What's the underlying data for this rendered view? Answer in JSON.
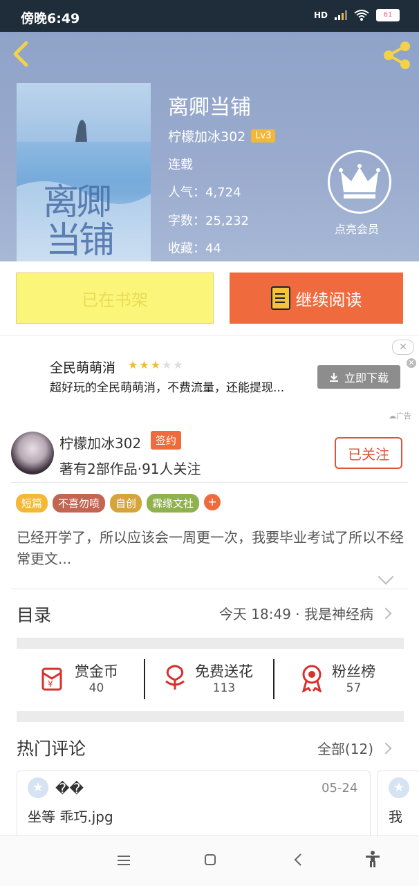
{
  "status": {
    "time": "傍晚6:49",
    "network": "HD",
    "battery": "61"
  },
  "book": {
    "title": "离卿当铺",
    "cover_text_1": "离卿",
    "cover_text_2": "当铺",
    "author": "柠檬加冰302",
    "level": "Lv3",
    "status": "连载",
    "popularity": "人气：4,724",
    "words": "字数：25,232",
    "favorites": "收藏：44",
    "member_label": "点亮会员"
  },
  "actions": {
    "shelf_label": "已在书架",
    "read_label": "继续阅读"
  },
  "ad": {
    "title": "全民萌萌消",
    "rating": 3,
    "desc": "超好玩的全民萌萌消，不费流量，还能提现...",
    "download_label": "立即下载",
    "close": "✕",
    "tag": "广告"
  },
  "author": {
    "name": "柠檬加冰302",
    "badge": "签约",
    "works": "著有2部作品·91人关注",
    "follow_label": "已关注"
  },
  "tags": [
    {
      "label": "短篇",
      "color": "#f3b83a"
    },
    {
      "label": "不喜勿喷",
      "color": "#c26552"
    },
    {
      "label": "自创",
      "color": "#d5a53a"
    },
    {
      "label": "霖缘文社",
      "color": "#8fb14e"
    }
  ],
  "tag_add": "+",
  "summary": "已经开学了，所以应该会一周更一次，我要毕业考试了所以不经常更文...",
  "toc": {
    "label": "目录",
    "latest": "今天 18:49 · 我是神经病"
  },
  "stats": [
    {
      "label": "赏金币",
      "value": "40",
      "icon": "red-envelope-icon"
    },
    {
      "label": "免费送花",
      "value": "113",
      "icon": "flower-icon"
    },
    {
      "label": "粉丝榜",
      "value": "57",
      "icon": "medal-icon"
    }
  ],
  "comments": {
    "label": "热门评论",
    "all_label": "全部(12)",
    "items": [
      {
        "name": "��",
        "date": "05-24",
        "text": "坐等 乖巧.jpg"
      },
      {
        "text": "我"
      }
    ]
  },
  "colors": {
    "accent": "#ef6a3c",
    "follow": "#e0533a",
    "shelf": "#fbf57a"
  }
}
